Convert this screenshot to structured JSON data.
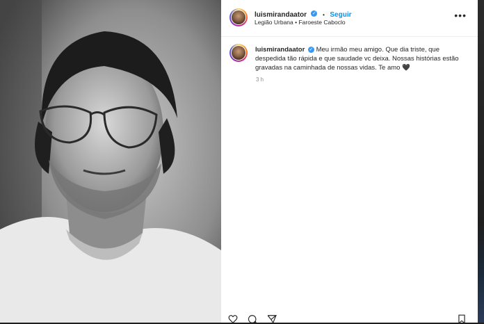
{
  "post": {
    "username": "luismirandaator",
    "follow_label": "Seguir",
    "location": "Legião Urbana • Faroeste Caboclo",
    "caption_username": "luismirandaator",
    "caption_text": "Meu irmão meu amigo. Que dia triste, que despedida tão rápida e que saudade vc deixa. Nossas histórias estão gravadas na caminhada de nossas vidas. Te amo",
    "heart_emoji": "🖤",
    "time": "3 h",
    "separator": "•"
  },
  "icons": {
    "verified": "verified-badge-icon",
    "more": "more-options-icon",
    "like": "heart-icon",
    "comment": "comment-icon",
    "share": "share-icon",
    "save": "bookmark-icon"
  },
  "colors": {
    "accent": "#0095f6",
    "verified": "#3897f0",
    "text": "#262626",
    "muted": "#8e8e8e"
  }
}
